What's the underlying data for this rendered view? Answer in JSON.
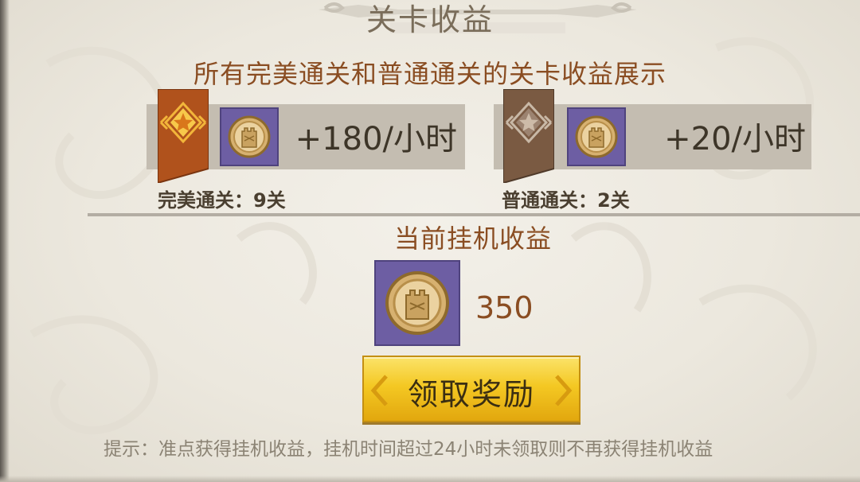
{
  "header": {
    "title": "关卡收益",
    "subtitle": "所有完美通关和普通通关的关卡收益展示"
  },
  "perfect": {
    "rate": "+180/小时",
    "label": "完美通关：9关",
    "flag_color": "#b0521c",
    "icon": "gold-star-icon"
  },
  "normal": {
    "rate": "+20/小时",
    "label": "普通通关：2关",
    "flag_color": "#7a5a42",
    "icon": "silver-star-icon"
  },
  "idle": {
    "title": "当前挂机收益",
    "value": "350",
    "icon": "tower-coin-icon"
  },
  "claim_button": {
    "label": "领取奖励"
  },
  "hint": "提示：准点获得挂机收益，挂机时间超过24小时未领取则不再获得挂机收益",
  "colors": {
    "accent_text": "#8a4d22",
    "coin_box_bg": "#6d5ea3",
    "button_gold": "#f4c823"
  }
}
